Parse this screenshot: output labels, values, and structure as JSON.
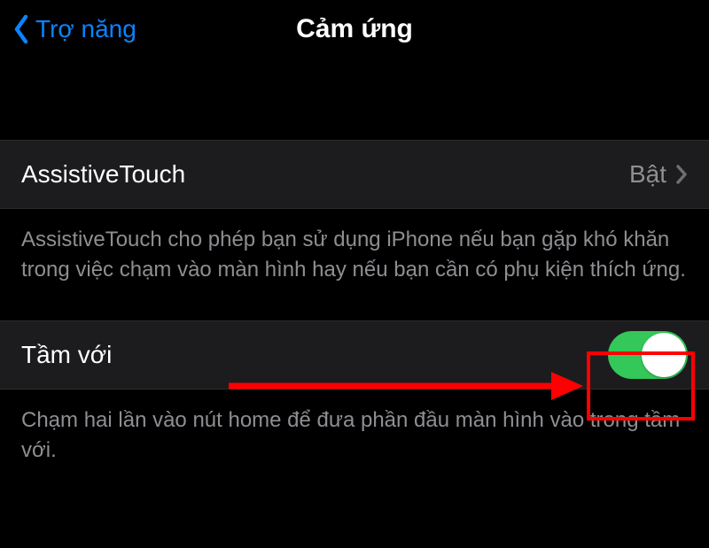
{
  "header": {
    "back_label": "Trợ năng",
    "title": "Cảm ứng"
  },
  "rows": [
    {
      "label": "AssistiveTouch",
      "value": "Bật",
      "footer": "AssistiveTouch cho phép bạn sử dụng iPhone nếu bạn gặp khó khăn trong việc chạm vào màn hình hay nếu bạn cần có phụ kiện thích ứng."
    },
    {
      "label": "Tầm với",
      "toggle_on": true,
      "footer": "Chạm hai lần vào nút home để đưa phần đầu màn hình vào trong tầm với."
    }
  ],
  "colors": {
    "link": "#0a84ff",
    "toggle_on": "#34c759",
    "highlight": "#ff0000"
  }
}
